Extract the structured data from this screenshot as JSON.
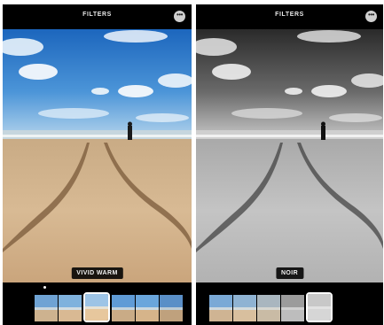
{
  "screens": [
    {
      "title": "FILTERS",
      "filter_name": "VIVID WARM",
      "more_icon": "ellipsis-icon",
      "thumbnails": [
        {
          "sky": "#6fa3d4",
          "sea": "#c9d6dd",
          "sand": "#cdb28f"
        },
        {
          "sky": "#7fb2dd",
          "sea": "#d2dde2",
          "sand": "#d9b993"
        },
        {
          "sky": "#9dc4e6",
          "sea": "#e6e2d6",
          "sand": "#e7c79d",
          "selected": true
        },
        {
          "sky": "#5f9bd6",
          "sea": "#c3d3dd",
          "sand": "#c9ab86"
        },
        {
          "sky": "#6aa6dc",
          "sea": "#cad8e0",
          "sand": "#d6b48a"
        },
        {
          "sky": "#5a8fc7",
          "sea": "#bccbd5",
          "sand": "#bfa17d"
        }
      ]
    },
    {
      "title": "FILTERS",
      "filter_name": "NOIR",
      "more_icon": "ellipsis-icon",
      "thumbnails": [
        {
          "sky": "#7aa9d6",
          "sea": "#cdd8de",
          "sand": "#cfb493"
        },
        {
          "sky": "#8fb3d3",
          "sea": "#d4dbdd",
          "sand": "#d8bf9e"
        },
        {
          "sky": "#a9b6bf",
          "sea": "#d6d6d0",
          "sand": "#c9bba5"
        },
        {
          "sky": "#9c9c9c",
          "sea": "#d0d0d0",
          "sand": "#bdbdbd"
        },
        {
          "sky": "#c8c8c8",
          "sea": "#e2e2e2",
          "sand": "#d6d6d6",
          "selected": true
        }
      ]
    }
  ],
  "colors": {
    "sky_top": "#1f6fc2",
    "sky_bottom": "#8fc0ea",
    "sand": "#d2b48e",
    "sand_dark": "#b89672",
    "track": "#6e5236"
  }
}
